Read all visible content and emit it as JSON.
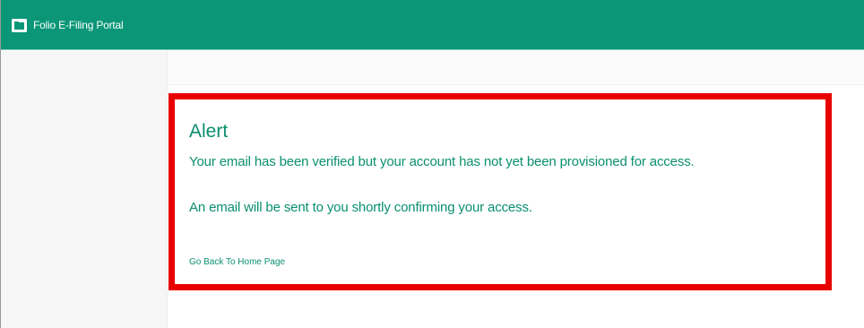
{
  "header": {
    "app_title": "Folio E-Filing Portal",
    "app_icon": "folder-window-icon"
  },
  "alert": {
    "title": "Alert",
    "message_1": "Your email has been verified but your account has not yet been provisioned for access.",
    "message_2": "An email will be sent to you shortly confirming your access.",
    "home_link": "Go Back To Home Page"
  },
  "colors": {
    "header_background": "#0a9677",
    "text_accent": "#0a8f6f",
    "highlight_border": "#e80000"
  }
}
